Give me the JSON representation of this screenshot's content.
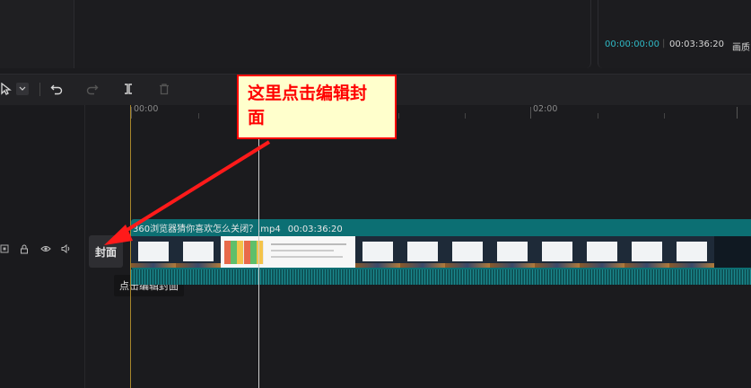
{
  "player": {
    "current_time": "00:00:00:00",
    "separator": "|",
    "total_time": "00:03:36:20",
    "quality_label": "画质"
  },
  "toolbar": {
    "select_tool": "select-pointer",
    "undo": "undo-icon",
    "redo": "redo-icon",
    "split": "split-icon",
    "delete": "delete-icon"
  },
  "ruler": {
    "labels": [
      "00:00",
      "02:00"
    ]
  },
  "track": {
    "cover_label": "封面",
    "cover_tooltip": "点击编辑封面",
    "clip_name": "360浏览器猜你喜欢怎么关闭？.mp4",
    "clip_duration": "00:03:36:20"
  },
  "annotation": {
    "callout_text": "这里点击编辑封面",
    "line1": "这里点击编辑封",
    "line2": "面",
    "border_color": "#ff0000",
    "fill_color": "#ffffcc"
  },
  "colors": {
    "accent_teal": "#2fb8c4",
    "clip_bg": "#0c6f73",
    "playhead_start": "#a8862b"
  }
}
